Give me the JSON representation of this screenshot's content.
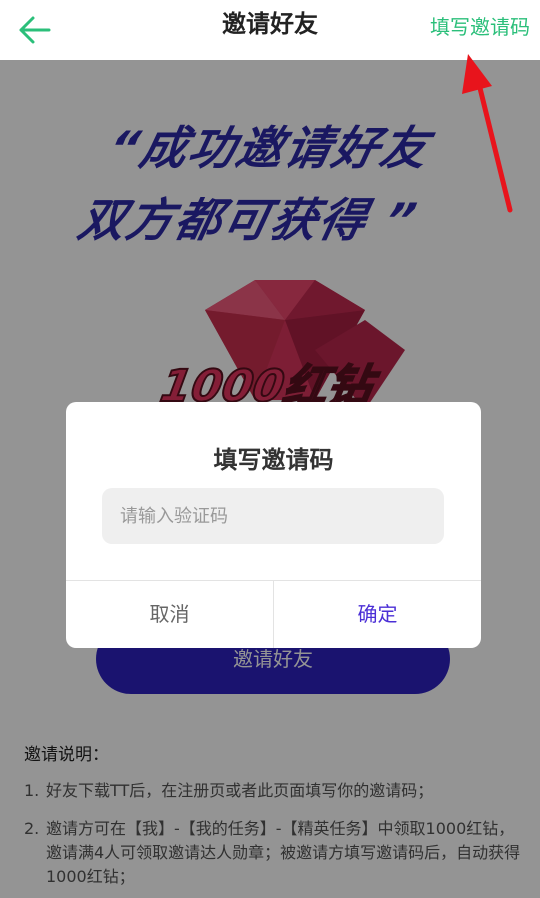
{
  "header": {
    "title": "邀请好友",
    "fill_code_label": "填写邀请码"
  },
  "hero": {
    "slogan_line1": "“成功邀请好友",
    "slogan_line2": "双方都可获得 ”",
    "badge": "1000红钻"
  },
  "invite_button_label": "邀请好友",
  "rules": {
    "title": "邀请说明：",
    "items": [
      {
        "num": "1.",
        "text": "好友下载TT后，在注册页或者此页面填写你的邀请码；"
      },
      {
        "num": "2.",
        "text": "邀请方可在【我】-【我的任务】-【精英任务】中领取1000红钻，邀请满4人可领取邀请达人勋章；被邀请方填写邀请码后，自动获得1000红钻；"
      }
    ]
  },
  "dialog": {
    "title": "填写邀请码",
    "input_placeholder": "请输入验证码",
    "input_value": "",
    "cancel_label": "取消",
    "confirm_label": "确定"
  },
  "colors": {
    "accent_green": "#2bbf7a",
    "button_purple": "#2e22c0",
    "confirm_text": "#4b2fd6",
    "annotation_red": "#e8141c"
  },
  "icons": {
    "back": "arrow-left-icon",
    "gem": "ruby-gem-icon"
  }
}
